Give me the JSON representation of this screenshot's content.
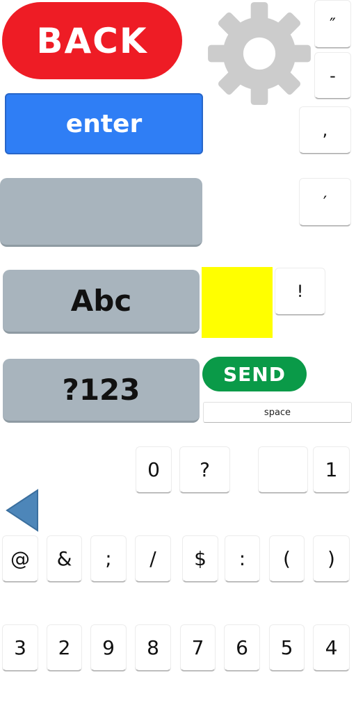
{
  "buttons": {
    "back_label": "BACK",
    "enter_label": "enter",
    "abc_label": "Abc",
    "num_label": "?123",
    "send_label": "SEND",
    "space_label": "space"
  },
  "side_keys": [
    "″",
    "-",
    ",",
    "′",
    "!"
  ],
  "row_mid": [
    "0",
    "?",
    "",
    "1"
  ],
  "row_symbols": [
    "@",
    "&",
    ";",
    "/",
    "$",
    ":",
    "(",
    ")"
  ],
  "row_digits": [
    "3",
    "2",
    "9",
    "8",
    "7",
    "6",
    "5",
    "4"
  ],
  "colors": {
    "back": "#ee1c25",
    "enter": "#2f7ef5",
    "gray_key": "#a8b4bd",
    "send": "#0a9a48",
    "yellow": "#ffff00",
    "gear": "#cccccc",
    "arrow": "#4d86b9"
  },
  "icons": {
    "settings": "gear-icon",
    "backspace": "left-arrow-icon"
  }
}
